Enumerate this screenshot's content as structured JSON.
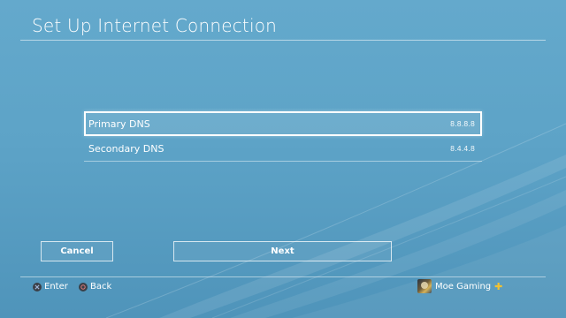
{
  "screen": {
    "title": "Set Up Internet Connection"
  },
  "dns": {
    "rows": [
      {
        "label": "Primary DNS",
        "value": "8.8.8.8"
      },
      {
        "label": "Secondary DNS",
        "value": "8.4.4.8"
      }
    ]
  },
  "buttons": {
    "cancel_label": "Cancel",
    "next_label": "Next"
  },
  "hints": {
    "enter_label": "Enter",
    "back_label": "Back",
    "enter_icon": "cross-button-icon",
    "back_icon": "circle-button-icon"
  },
  "user": {
    "name": "Moe Gaming",
    "badge_icon": "playstation-plus-icon"
  },
  "colors": {
    "background": "#5da3c7",
    "text": "#ffffff",
    "plus_badge": "#f2c230"
  }
}
